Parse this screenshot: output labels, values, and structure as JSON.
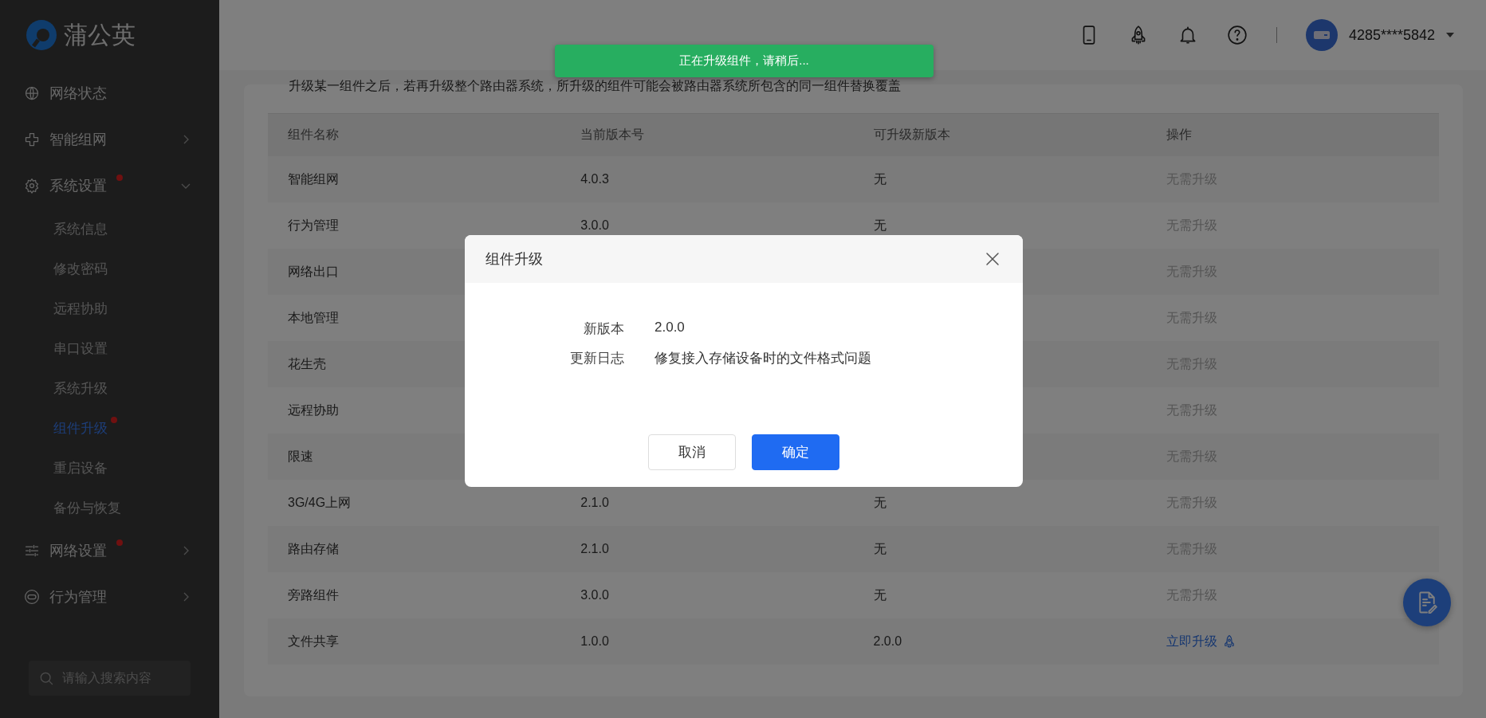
{
  "sidebar": {
    "logo": "蒲公英",
    "menu": [
      {
        "label": "网络状态",
        "kind": "link",
        "dot": false
      },
      {
        "label": "智能组网",
        "kind": "group",
        "expanded": false,
        "dot": false
      },
      {
        "label": "系统设置",
        "kind": "group",
        "expanded": true,
        "dot": true,
        "children": [
          {
            "label": "系统信息",
            "selected": false,
            "dot": false
          },
          {
            "label": "修改密码",
            "selected": false,
            "dot": false
          },
          {
            "label": "远程协助",
            "selected": false,
            "dot": false
          },
          {
            "label": "串口设置",
            "selected": false,
            "dot": false
          },
          {
            "label": "系统升级",
            "selected": false,
            "dot": false
          },
          {
            "label": "组件升级",
            "selected": true,
            "dot": true
          },
          {
            "label": "重启设备",
            "selected": false,
            "dot": false
          },
          {
            "label": "备份与恢复",
            "selected": false,
            "dot": false
          }
        ]
      },
      {
        "label": "网络设置",
        "kind": "group",
        "expanded": false,
        "dot": true
      },
      {
        "label": "行为管理",
        "kind": "group",
        "expanded": false,
        "dot": false
      }
    ],
    "search": {
      "placeholder": "请输入搜索内容"
    }
  },
  "header": {
    "account": "4285****5842"
  },
  "notice": "升级某一组件之后，若再升级整个路由器系统，所升级的组件可能会被路由器系统所包含的同一组件替换覆盖",
  "table": {
    "columns": [
      "组件名称",
      "当前版本号",
      "可升级新版本",
      "操作"
    ],
    "rows": [
      {
        "cells": [
          "智能组网",
          "4.0.3",
          "无"
        ],
        "action": {
          "label": "无需升级",
          "kind": "none"
        }
      },
      {
        "cells": [
          "行为管理",
          "3.0.0",
          "无"
        ],
        "action": {
          "label": "无需升级",
          "kind": "none"
        }
      },
      {
        "cells": [
          "网络出口",
          "",
          ""
        ],
        "action": {
          "label": "无需升级",
          "kind": "none"
        }
      },
      {
        "cells": [
          "本地管理",
          "",
          ""
        ],
        "action": {
          "label": "无需升级",
          "kind": "none"
        }
      },
      {
        "cells": [
          "花生壳",
          "",
          ""
        ],
        "action": {
          "label": "无需升级",
          "kind": "none"
        }
      },
      {
        "cells": [
          "远程协助",
          "",
          ""
        ],
        "action": {
          "label": "无需升级",
          "kind": "none"
        }
      },
      {
        "cells": [
          "限速",
          "",
          ""
        ],
        "action": {
          "label": "无需升级",
          "kind": "none"
        }
      },
      {
        "cells": [
          "3G/4G上网",
          "2.1.0",
          "无"
        ],
        "action": {
          "label": "无需升级",
          "kind": "none"
        }
      },
      {
        "cells": [
          "路由存储",
          "2.1.0",
          "无"
        ],
        "action": {
          "label": "无需升级",
          "kind": "none"
        }
      },
      {
        "cells": [
          "旁路组件",
          "3.0.0",
          "无"
        ],
        "action": {
          "label": "无需升级",
          "kind": "none"
        }
      },
      {
        "cells": [
          "文件共享",
          "1.0.0",
          "2.0.0"
        ],
        "action": {
          "label": "立即升级",
          "kind": "upgrade"
        }
      }
    ]
  },
  "toast": "正在升级组件，请稍后...",
  "dialog": {
    "title": "组件升级",
    "fields": [
      {
        "label": "新版本",
        "value": "2.0.0"
      },
      {
        "label": "更新日志",
        "value": "修复接入存储设备时的文件格式问题"
      }
    ],
    "buttons": [
      {
        "label": "取消",
        "kind": "secondary"
      },
      {
        "label": "确定",
        "kind": "primary"
      }
    ]
  }
}
